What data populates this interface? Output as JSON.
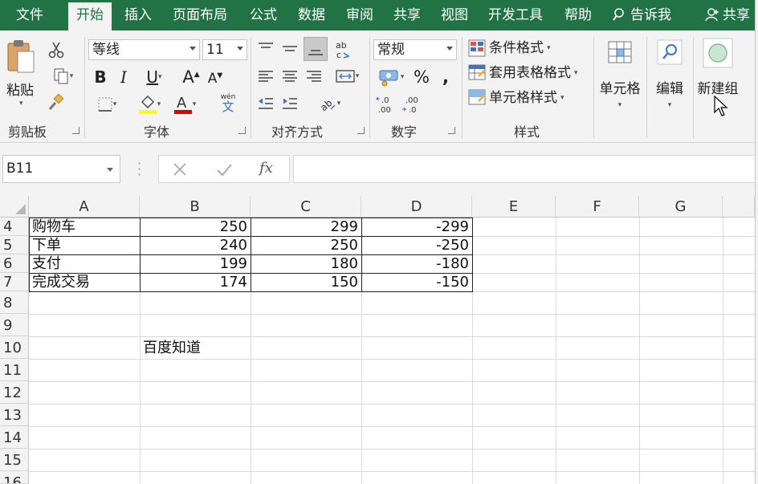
{
  "menu": {
    "tabs": [
      {
        "label": "文件"
      },
      {
        "label": "开始"
      },
      {
        "label": "插入"
      },
      {
        "label": "页面布局"
      },
      {
        "label": "公式"
      },
      {
        "label": "数据"
      },
      {
        "label": "审阅"
      },
      {
        "label": "共享"
      },
      {
        "label": "视图"
      },
      {
        "label": "开发工具"
      },
      {
        "label": "帮助"
      }
    ],
    "active_tab": "开始",
    "tell_me": "告诉我",
    "share": "共享"
  },
  "ribbon": {
    "clipboard": {
      "paste_label": "粘贴",
      "group_label": "剪贴板"
    },
    "font": {
      "font_name": "等线",
      "font_size": "11",
      "phonetic_label": "wén",
      "phonetic_char": "文",
      "group_label": "字体",
      "highlight_color": "#ffff00",
      "font_color": "#e00000"
    },
    "alignment": {
      "group_label": "对齐方式"
    },
    "number": {
      "format": "常规",
      "group_label": "数字"
    },
    "styles": {
      "conditional_format": "条件格式",
      "format_as_table": "套用表格格式",
      "cell_styles": "单元格样式",
      "group_label": "样式"
    },
    "cells": {
      "label": "单元格"
    },
    "editing": {
      "label": "编辑"
    },
    "new_group": {
      "label": "新建组"
    }
  },
  "formula_bar": {
    "name_box": "B11",
    "fx_label": "fx",
    "formula": ""
  },
  "sheet": {
    "columns": [
      "A",
      "B",
      "C",
      "D",
      "E",
      "F",
      "G"
    ],
    "rows": [
      "4",
      "5",
      "6",
      "7",
      "8",
      "9",
      "10",
      "11",
      "12",
      "13",
      "14",
      "15",
      "16"
    ],
    "data": [
      {
        "row": "4",
        "a": "购物车",
        "b": "250",
        "c": "299",
        "d": "-299"
      },
      {
        "row": "5",
        "a": "下单",
        "b": "240",
        "c": "250",
        "d": "-250"
      },
      {
        "row": "6",
        "a": "支付",
        "b": "199",
        "c": "180",
        "d": "-180"
      },
      {
        "row": "7",
        "a": "完成交易",
        "b": "174",
        "c": "150",
        "d": "-150"
      }
    ],
    "b10": "百度知道"
  }
}
